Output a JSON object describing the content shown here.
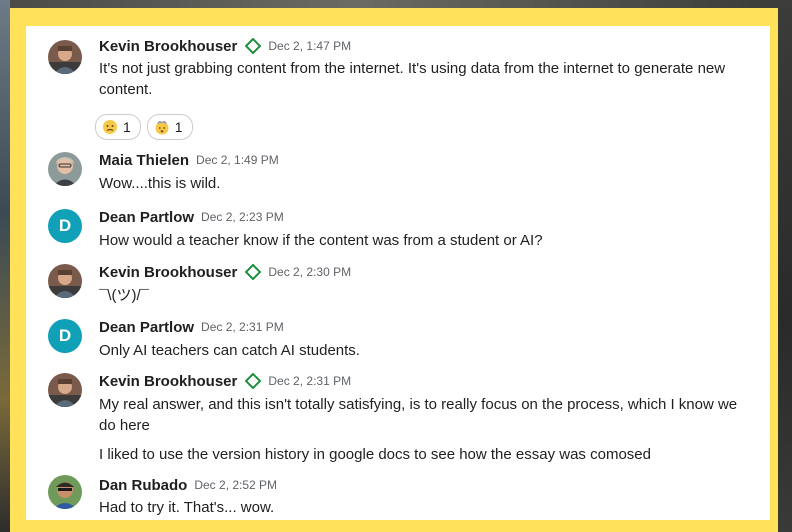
{
  "messages": [
    {
      "author": "Kevin Brookhouser",
      "time": "Dec 2, 1:47 PM",
      "lines": [
        "It's not just grabbing content from the internet. It's using data from the internet to generate new",
        "content."
      ],
      "reactions": [
        {
          "emoji": "disappointed-face-icon",
          "count": "1"
        },
        {
          "emoji": "exploding-head-icon",
          "count": "1"
        }
      ]
    },
    {
      "author": "Maia Thielen",
      "time": "Dec 2, 1:49 PM",
      "lines": [
        "Wow....this is wild."
      ]
    },
    {
      "author": "Dean Partlow",
      "avatar_letter": "D",
      "time": "Dec 2, 2:23 PM",
      "lines": [
        "How would a teacher know if the content was from a student or AI?"
      ]
    },
    {
      "author": "Kevin Brookhouser",
      "time": "Dec 2, 2:30 PM",
      "lines": [
        "¯\\(ツ)/¯"
      ]
    },
    {
      "author": "Dean Partlow",
      "avatar_letter": "D",
      "time": "Dec 2, 2:31 PM",
      "lines": [
        "Only AI teachers can catch AI students."
      ]
    },
    {
      "author": "Kevin Brookhouser",
      "time": "Dec 2, 2:31 PM",
      "lines": [
        "My real answer, and this isn't totally satisfying, is to really focus on the process, which I know we",
        "do here",
        "I liked to use the version history in google docs to see how the essay was comosed"
      ]
    },
    {
      "author": "Dan Rubado",
      "time": "Dec 2, 2:52 PM",
      "lines": [
        "Had to try it. That's... wow."
      ]
    }
  ],
  "colors": {
    "frame": "#ffe15a",
    "avatar_letter_bg": "#10a0b8",
    "verified_badge": "#1e8e3e"
  }
}
